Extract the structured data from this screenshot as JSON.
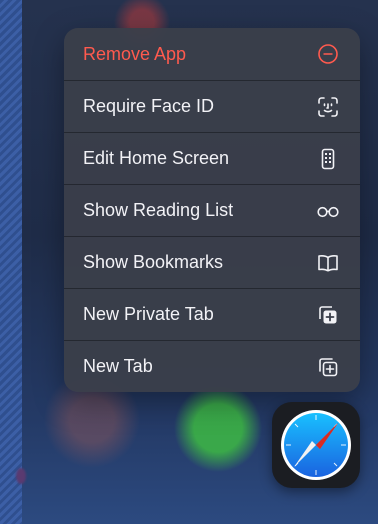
{
  "menu": {
    "items": [
      {
        "label": "Remove App",
        "icon": "minus-circle-icon",
        "destructive": true
      },
      {
        "label": "Require Face ID",
        "icon": "face-id-icon"
      },
      {
        "label": "Edit Home Screen",
        "icon": "phone-grid-icon"
      },
      {
        "label": "Show Reading List",
        "icon": "glasses-icon"
      },
      {
        "label": "Show Bookmarks",
        "icon": "book-icon"
      },
      {
        "label": "New Private Tab",
        "icon": "private-tab-icon"
      },
      {
        "label": "New Tab",
        "icon": "new-tab-icon"
      }
    ]
  },
  "colors": {
    "destructive": "#ff5a4e",
    "menu_text": "#f2f2f6",
    "menu_background": "#3a3e4a"
  },
  "app_icon": {
    "name": "safari-icon"
  }
}
